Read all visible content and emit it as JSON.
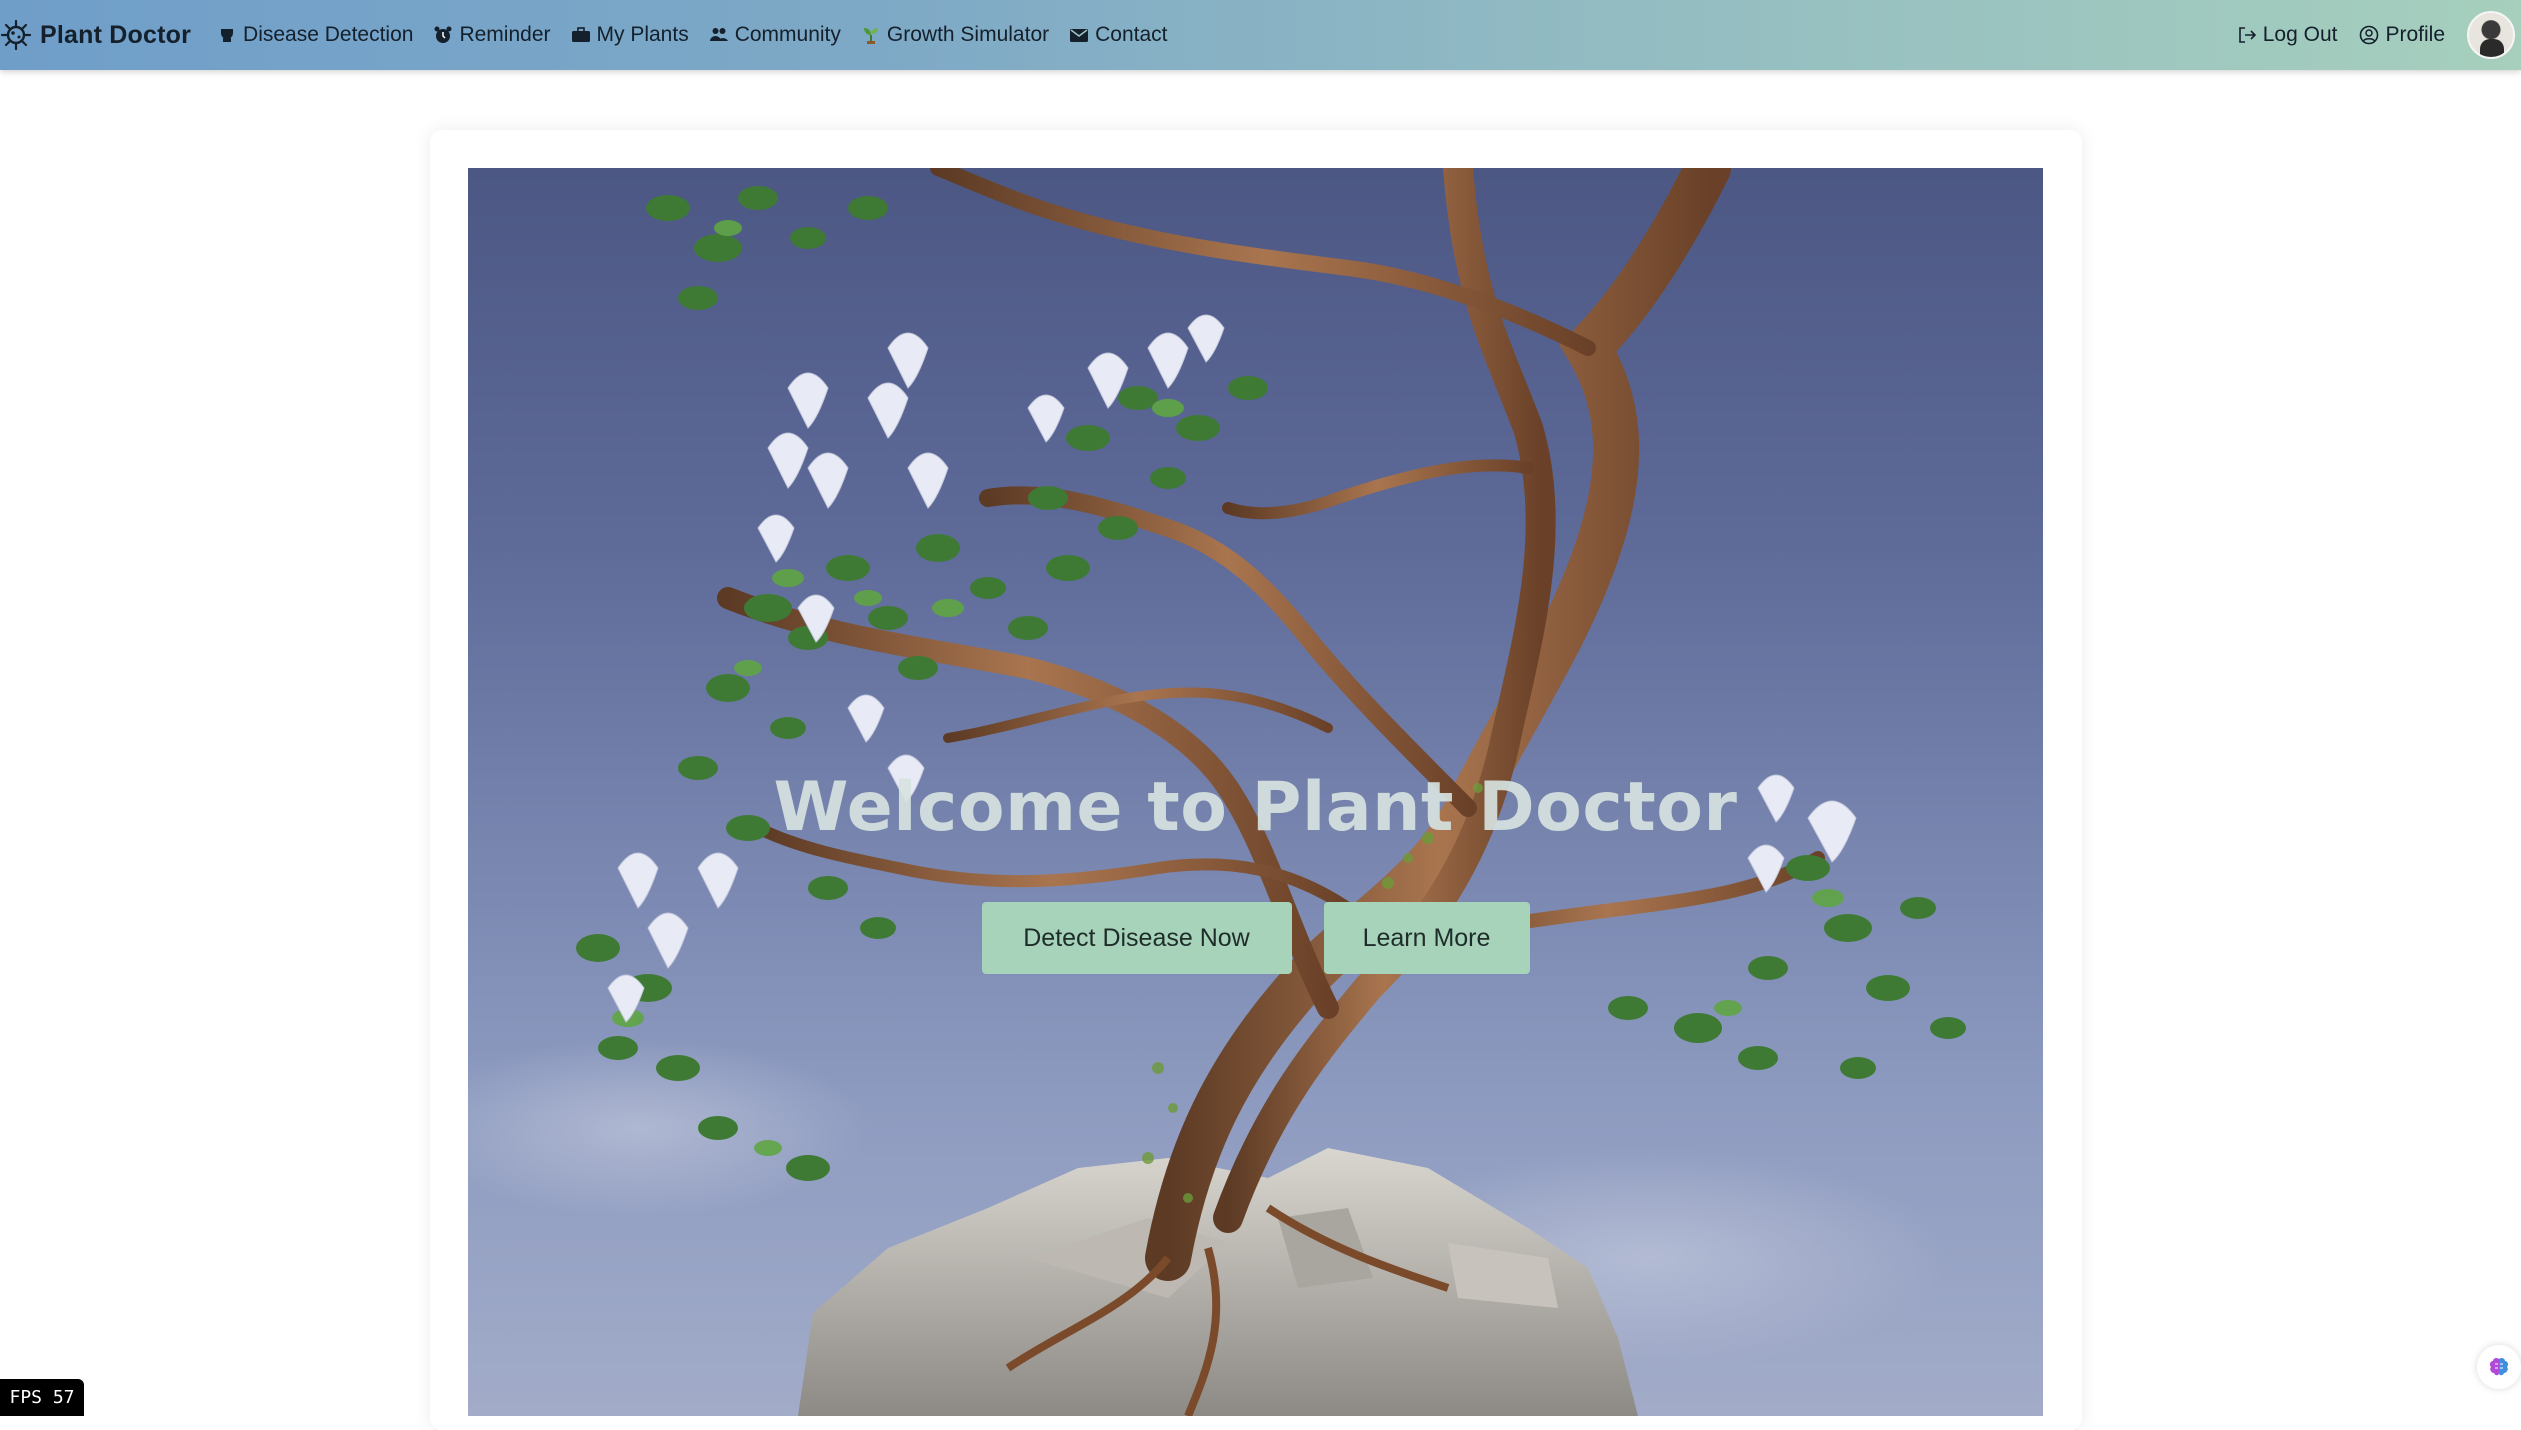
{
  "nav": {
    "brand": "Plant Doctor",
    "items": [
      {
        "label": "Disease Detection",
        "icon": "virus-icon"
      },
      {
        "label": "Reminder",
        "icon": "alarm-clock-icon"
      },
      {
        "label": "My Plants",
        "icon": "briefcase-icon"
      },
      {
        "label": "Community",
        "icon": "users-icon"
      },
      {
        "label": "Growth Simulator",
        "icon": "seedling-icon"
      },
      {
        "label": "Contact",
        "icon": "envelope-icon"
      }
    ],
    "logout": "Log Out",
    "profile": "Profile"
  },
  "hero": {
    "title": "Welcome to Plant Doctor",
    "primary_button": "Detect Disease Now",
    "secondary_button": "Learn More"
  },
  "fps": "FPS 57",
  "colors": {
    "nav_gradient_start": "#6f9ec9",
    "nav_gradient_end": "#a6cfbd",
    "button_bg": "#a6d3ba",
    "sky_top": "#4c5784",
    "sky_bottom": "#a2acc9"
  }
}
